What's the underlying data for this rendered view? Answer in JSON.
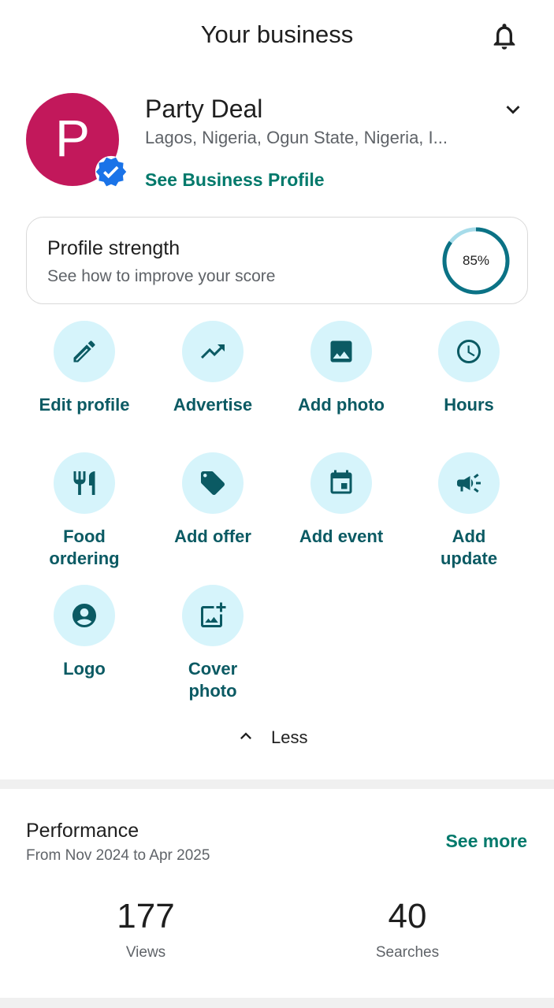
{
  "header": {
    "title": "Your business",
    "bell_icon": "bell-outline-icon"
  },
  "business": {
    "avatar_letter": "P",
    "avatar_color": "#c2185b",
    "verified_icon": "verified-badge-icon",
    "name": "Party Deal",
    "location": "Lagos, Nigeria, Ogun State, Nigeria, I...",
    "profile_link": "See Business Profile",
    "dropdown_icon": "chevron-down-icon"
  },
  "profile_strength": {
    "title": "Profile strength",
    "subtitle": "See how to improve your score",
    "value_label": "85%",
    "value": 0.85,
    "ring_color": "#0b7285",
    "track_color": "#a7dcea"
  },
  "actions": [
    {
      "label": "Edit profile",
      "icon": "pencil-icon"
    },
    {
      "label": "Advertise",
      "icon": "trending-up-icon"
    },
    {
      "label": "Add photo",
      "icon": "image-icon"
    },
    {
      "label": "Hours",
      "icon": "clock-icon"
    },
    {
      "label": "Food ordering",
      "icon": "fork-knife-icon"
    },
    {
      "label": "Add offer",
      "icon": "tag-icon"
    },
    {
      "label": "Add event",
      "icon": "calendar-event-icon"
    },
    {
      "label": "Add update",
      "icon": "megaphone-icon"
    },
    {
      "label": "Logo",
      "icon": "account-circle-icon"
    },
    {
      "label": "Cover photo",
      "icon": "add-photo-icon"
    }
  ],
  "less_toggle": {
    "label": "Less",
    "icon": "chevron-up-icon"
  },
  "performance": {
    "title": "Performance",
    "range": "From Nov 2024 to Apr 2025",
    "see_more": "See more",
    "stats": [
      {
        "value": "177",
        "label": "Views"
      },
      {
        "value": "40",
        "label": "Searches"
      }
    ]
  },
  "colors": {
    "accent": "#00796b",
    "action_icon": "#0b5a63",
    "action_circle": "#d6f4fb",
    "verified": "#1a73e8"
  }
}
